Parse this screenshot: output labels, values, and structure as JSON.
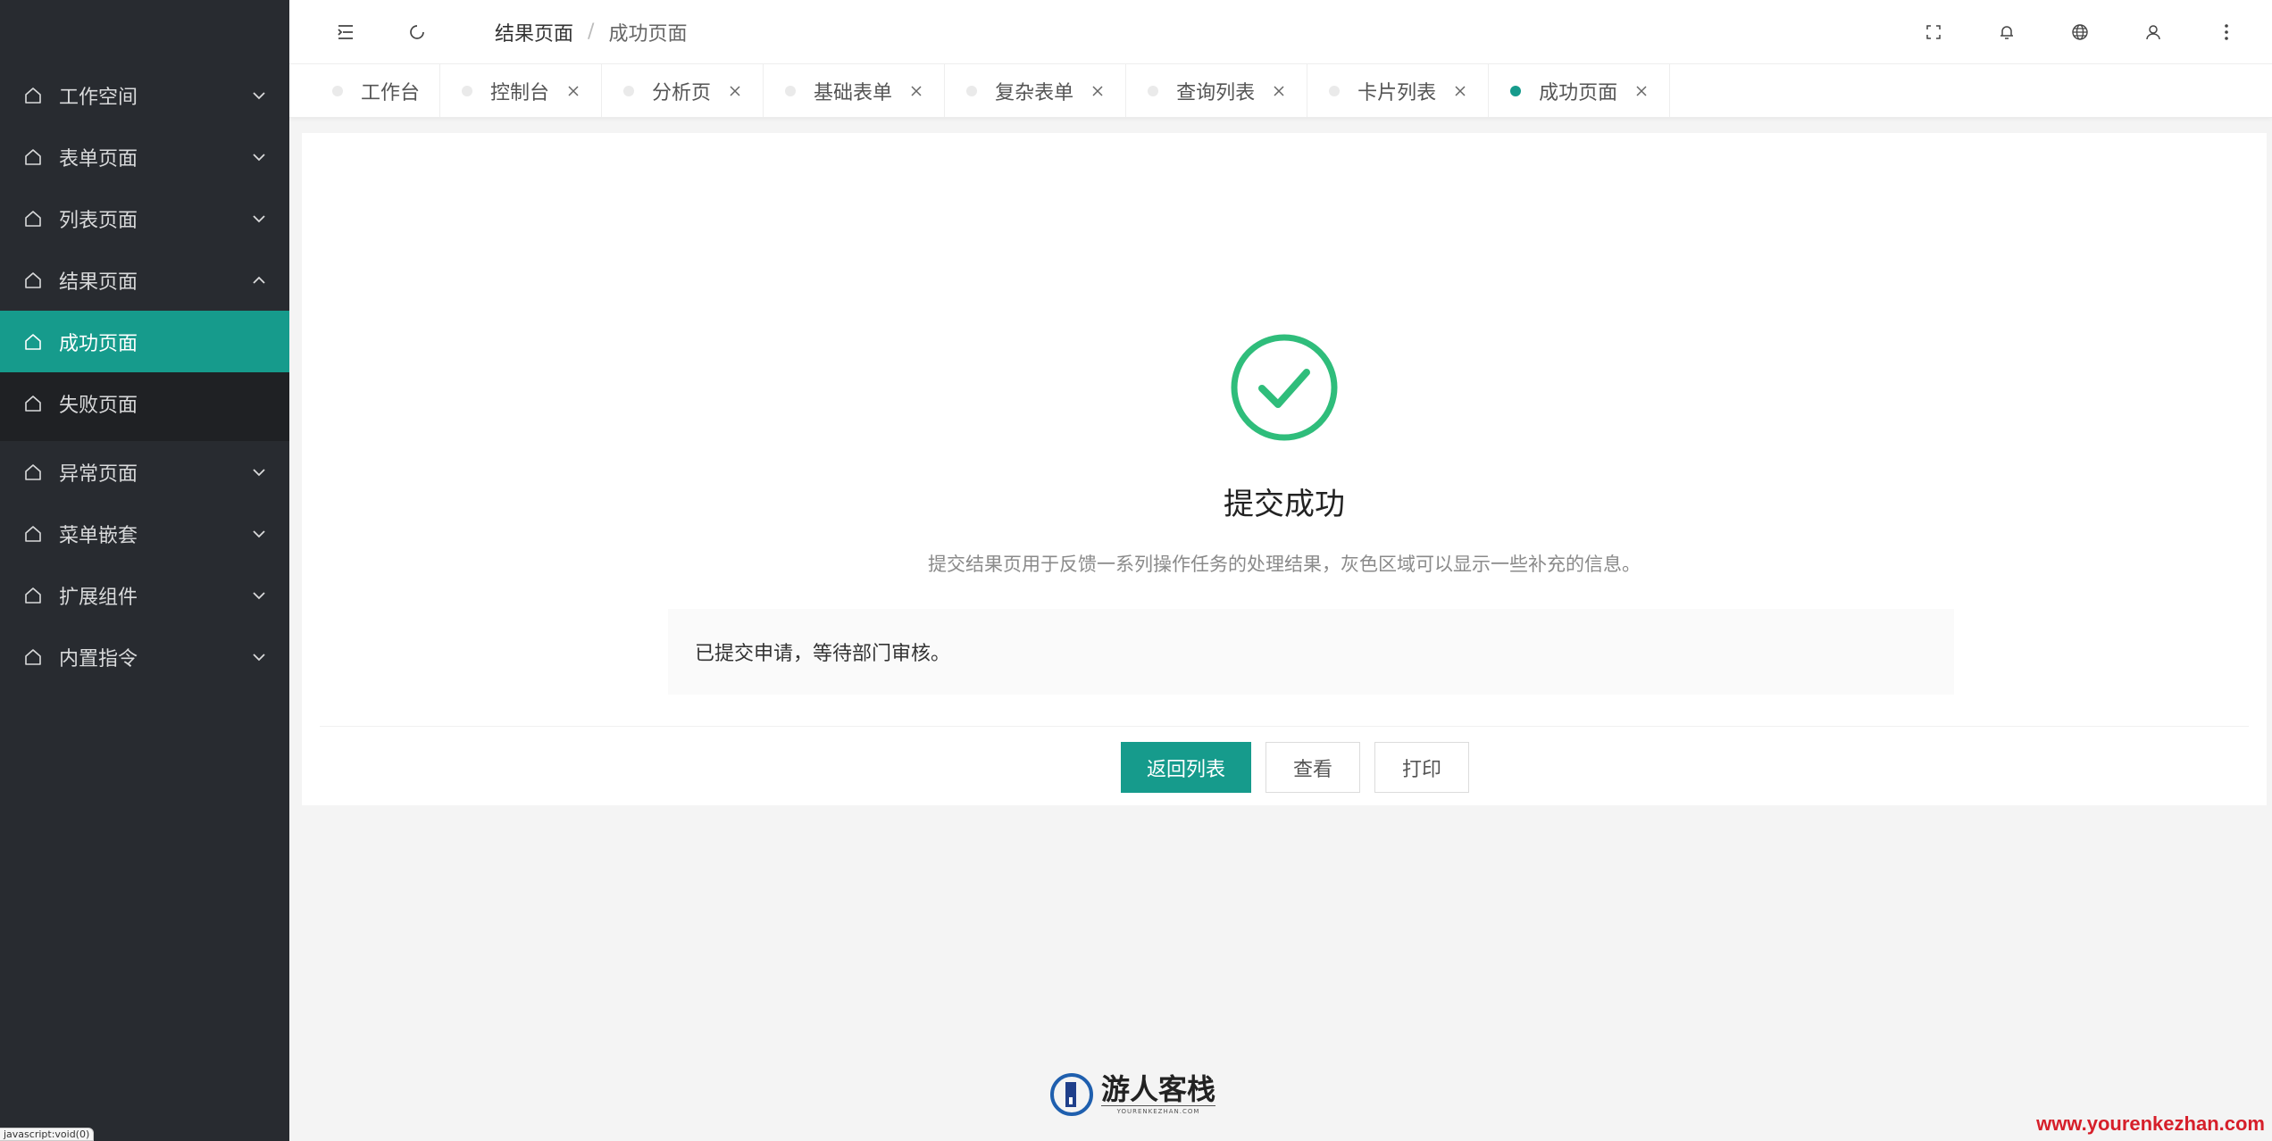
{
  "sidebar": {
    "items": [
      {
        "label": "工作空间",
        "expanded": false
      },
      {
        "label": "表单页面",
        "expanded": false
      },
      {
        "label": "列表页面",
        "expanded": false
      },
      {
        "label": "结果页面",
        "expanded": true
      },
      {
        "label": "异常页面",
        "expanded": false
      },
      {
        "label": "菜单嵌套",
        "expanded": false
      },
      {
        "label": "扩展组件",
        "expanded": false
      },
      {
        "label": "内置指令",
        "expanded": false
      }
    ],
    "submenu": [
      {
        "label": "成功页面",
        "active": true
      },
      {
        "label": "失败页面",
        "active": false
      }
    ]
  },
  "header": {
    "breadcrumb": [
      "结果页面",
      "成功页面"
    ],
    "separator": "/",
    "icons": [
      "collapse-menu-icon",
      "refresh-icon",
      "fullscreen-icon",
      "bell-icon",
      "globe-icon",
      "user-icon",
      "more-icon"
    ]
  },
  "tabs": [
    {
      "label": "工作台",
      "closable": false
    },
    {
      "label": "控制台",
      "closable": true
    },
    {
      "label": "分析页",
      "closable": true
    },
    {
      "label": "基础表单",
      "closable": true
    },
    {
      "label": "复杂表单",
      "closable": true
    },
    {
      "label": "查询列表",
      "closable": true
    },
    {
      "label": "卡片列表",
      "closable": true
    },
    {
      "label": "成功页面",
      "closable": true,
      "active": true
    }
  ],
  "result": {
    "title": "提交成功",
    "description": "提交结果页用于反馈一系列操作任务的处理结果，灰色区域可以显示一些补充的信息。",
    "extra": "已提交申请，等待部门审核。",
    "actions": {
      "primary": "返回列表",
      "view": "查看",
      "print": "打印"
    }
  },
  "watermark": {
    "logo_text": "游人客栈",
    "logo_sub": "YOURENKEZHAN.COM",
    "url": "www.yourenkezhan.com"
  },
  "status_bar": "javascript:void(0)",
  "colors": {
    "accent": "#169b8c",
    "sidebar_bg": "#282b30",
    "success": "#2fbd7b",
    "watermark_red": "#d61f2a"
  }
}
